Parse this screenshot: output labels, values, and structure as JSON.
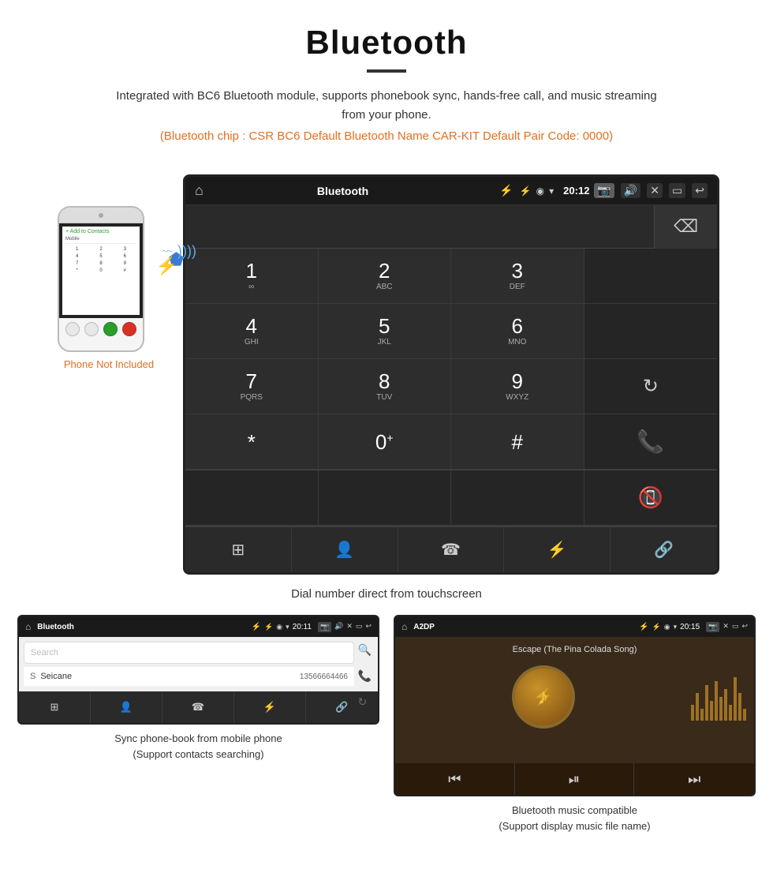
{
  "header": {
    "title": "Bluetooth",
    "description": "Integrated with BC6 Bluetooth module, supports phonebook sync, hands-free call, and music streaming from your phone.",
    "specs": "(Bluetooth chip : CSR BC6    Default Bluetooth Name CAR-KIT    Default Pair Code: 0000)"
  },
  "dial_screen": {
    "status_bar": {
      "title": "Bluetooth",
      "time": "20:12"
    },
    "keypad": [
      {
        "number": "1",
        "sub": "∞"
      },
      {
        "number": "2",
        "sub": "ABC"
      },
      {
        "number": "3",
        "sub": "DEF"
      },
      {
        "number": "4",
        "sub": "GHI"
      },
      {
        "number": "5",
        "sub": "JKL"
      },
      {
        "number": "6",
        "sub": "MNO"
      },
      {
        "number": "7",
        "sub": "PQRS"
      },
      {
        "number": "8",
        "sub": "TUV"
      },
      {
        "number": "9",
        "sub": "WXYZ"
      },
      {
        "number": "*",
        "sub": ""
      },
      {
        "number": "0",
        "sub": "+"
      },
      {
        "number": "#",
        "sub": ""
      }
    ],
    "caption": "Dial number direct from touchscreen"
  },
  "phone_illustration": {
    "not_included_text": "Phone Not Included"
  },
  "phonebook_screen": {
    "status_bar": {
      "title": "Bluetooth",
      "time": "20:11"
    },
    "search_placeholder": "Search",
    "contact": {
      "letter": "S",
      "name": "Seicane",
      "number": "13566664466"
    },
    "caption_line1": "Sync phone-book from mobile phone",
    "caption_line2": "(Support contacts searching)"
  },
  "music_screen": {
    "status_bar": {
      "title": "A2DP",
      "time": "20:15"
    },
    "song_title": "Escape (The Pina Colada Song)",
    "caption_line1": "Bluetooth music compatible",
    "caption_line2": "(Support display music file name)"
  }
}
